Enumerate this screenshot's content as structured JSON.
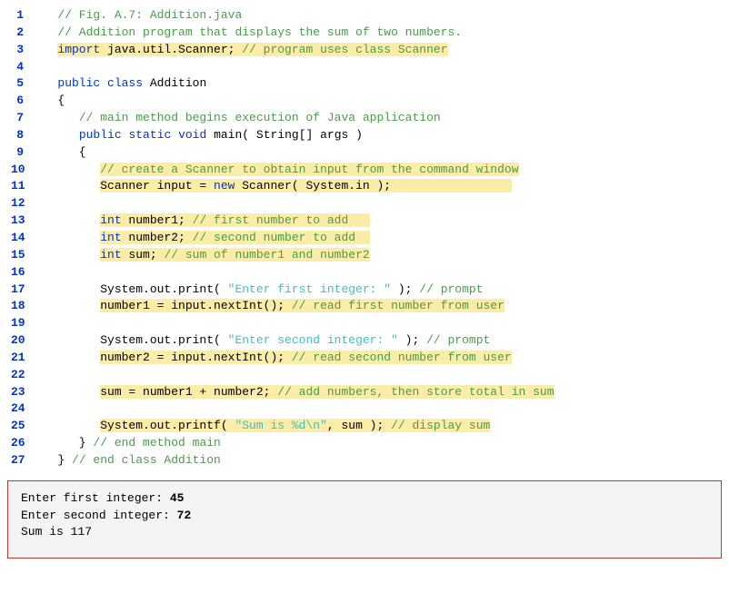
{
  "lines": [
    {
      "n": "1",
      "segs": [
        {
          "t": "   ",
          "c": ""
        },
        {
          "t": "// Fig. A.7: Addition.java",
          "c": "comment"
        }
      ]
    },
    {
      "n": "2",
      "segs": [
        {
          "t": "   ",
          "c": ""
        },
        {
          "t": "// Addition program that displays the sum of two numbers.",
          "c": "comment"
        }
      ]
    },
    {
      "n": "3",
      "segs": [
        {
          "t": "   ",
          "c": ""
        },
        {
          "t": "import",
          "c": "keyword hl"
        },
        {
          "t": " java.util.Scanner; ",
          "c": "ident hl"
        },
        {
          "t": "// program uses class Scanner",
          "c": "comment hl"
        }
      ]
    },
    {
      "n": "4",
      "segs": []
    },
    {
      "n": "5",
      "segs": [
        {
          "t": "   ",
          "c": ""
        },
        {
          "t": "public",
          "c": "keyword"
        },
        {
          "t": " ",
          "c": ""
        },
        {
          "t": "class",
          "c": "keyword"
        },
        {
          "t": " Addition",
          "c": "ident"
        }
      ]
    },
    {
      "n": "6",
      "segs": [
        {
          "t": "   {",
          "c": "punct"
        }
      ]
    },
    {
      "n": "7",
      "segs": [
        {
          "t": "      ",
          "c": ""
        },
        {
          "t": "// main method begins execution of Java application",
          "c": "comment"
        }
      ]
    },
    {
      "n": "8",
      "segs": [
        {
          "t": "      ",
          "c": ""
        },
        {
          "t": "public",
          "c": "keyword"
        },
        {
          "t": " ",
          "c": ""
        },
        {
          "t": "static",
          "c": "keyword"
        },
        {
          "t": " ",
          "c": ""
        },
        {
          "t": "void",
          "c": "keyword"
        },
        {
          "t": " main( String[] args )",
          "c": "ident"
        }
      ]
    },
    {
      "n": "9",
      "segs": [
        {
          "t": "      {",
          "c": "punct"
        }
      ]
    },
    {
      "n": "10",
      "segs": [
        {
          "t": "         ",
          "c": ""
        },
        {
          "t": "// create a Scanner to obtain input from the command window",
          "c": "comment hl"
        }
      ]
    },
    {
      "n": "11",
      "segs": [
        {
          "t": "         ",
          "c": ""
        },
        {
          "t": "Scanner input = ",
          "c": "ident hl"
        },
        {
          "t": "new",
          "c": "keyword hl"
        },
        {
          "t": " Scanner( System.in );",
          "c": "ident hl"
        },
        {
          "t": "                 ",
          "c": "hl"
        }
      ]
    },
    {
      "n": "12",
      "segs": []
    },
    {
      "n": "13",
      "segs": [
        {
          "t": "         ",
          "c": ""
        },
        {
          "t": "int",
          "c": "keyword hl"
        },
        {
          "t": " number1; ",
          "c": "ident hl"
        },
        {
          "t": "// first number to add   ",
          "c": "comment hl"
        }
      ]
    },
    {
      "n": "14",
      "segs": [
        {
          "t": "         ",
          "c": ""
        },
        {
          "t": "int",
          "c": "keyword hl"
        },
        {
          "t": " number2; ",
          "c": "ident hl"
        },
        {
          "t": "// second number to add  ",
          "c": "comment hl"
        }
      ]
    },
    {
      "n": "15",
      "segs": [
        {
          "t": "         ",
          "c": ""
        },
        {
          "t": "int",
          "c": "keyword hl"
        },
        {
          "t": " sum; ",
          "c": "ident hl"
        },
        {
          "t": "// sum of number1 and number2",
          "c": "comment hl"
        }
      ]
    },
    {
      "n": "16",
      "segs": []
    },
    {
      "n": "17",
      "segs": [
        {
          "t": "         System.out.print( ",
          "c": "ident"
        },
        {
          "t": "\"Enter first integer: \"",
          "c": "string"
        },
        {
          "t": " ); ",
          "c": "ident"
        },
        {
          "t": "// prompt",
          "c": "comment"
        }
      ]
    },
    {
      "n": "18",
      "segs": [
        {
          "t": "         ",
          "c": ""
        },
        {
          "t": "number1 = input.nextInt(); ",
          "c": "ident hl"
        },
        {
          "t": "// read first number from user",
          "c": "comment hl"
        }
      ]
    },
    {
      "n": "19",
      "segs": []
    },
    {
      "n": "20",
      "segs": [
        {
          "t": "         System.out.print( ",
          "c": "ident"
        },
        {
          "t": "\"Enter second integer: \"",
          "c": "string"
        },
        {
          "t": " ); ",
          "c": "ident"
        },
        {
          "t": "// prompt",
          "c": "comment"
        }
      ]
    },
    {
      "n": "21",
      "segs": [
        {
          "t": "         ",
          "c": ""
        },
        {
          "t": "number2 = input.nextInt(); ",
          "c": "ident hl"
        },
        {
          "t": "// read second number from user",
          "c": "comment hl"
        }
      ]
    },
    {
      "n": "22",
      "segs": []
    },
    {
      "n": "23",
      "segs": [
        {
          "t": "         ",
          "c": ""
        },
        {
          "t": "sum = number1 + number2; ",
          "c": "ident hl"
        },
        {
          "t": "// add numbers, then store total in sum",
          "c": "comment hl"
        }
      ]
    },
    {
      "n": "24",
      "segs": []
    },
    {
      "n": "25",
      "segs": [
        {
          "t": "         ",
          "c": ""
        },
        {
          "t": "System.out.printf( ",
          "c": "ident hl"
        },
        {
          "t": "\"Sum is %d\\n\"",
          "c": "string hl"
        },
        {
          "t": ", sum ); ",
          "c": "ident hl"
        },
        {
          "t": "// display sum",
          "c": "comment hl"
        }
      ]
    },
    {
      "n": "26",
      "segs": [
        {
          "t": "      } ",
          "c": "punct"
        },
        {
          "t": "// end method main",
          "c": "comment"
        }
      ]
    },
    {
      "n": "27",
      "segs": [
        {
          "t": "   } ",
          "c": "punct"
        },
        {
          "t": "// end class Addition",
          "c": "comment"
        }
      ]
    }
  ],
  "output": [
    {
      "runs": [
        {
          "t": "Enter first integer: ",
          "b": false
        },
        {
          "t": "45",
          "b": true
        }
      ]
    },
    {
      "runs": [
        {
          "t": "Enter second integer: ",
          "b": false
        },
        {
          "t": "72",
          "b": true
        }
      ]
    },
    {
      "runs": [
        {
          "t": "Sum is 117",
          "b": false
        }
      ]
    }
  ]
}
